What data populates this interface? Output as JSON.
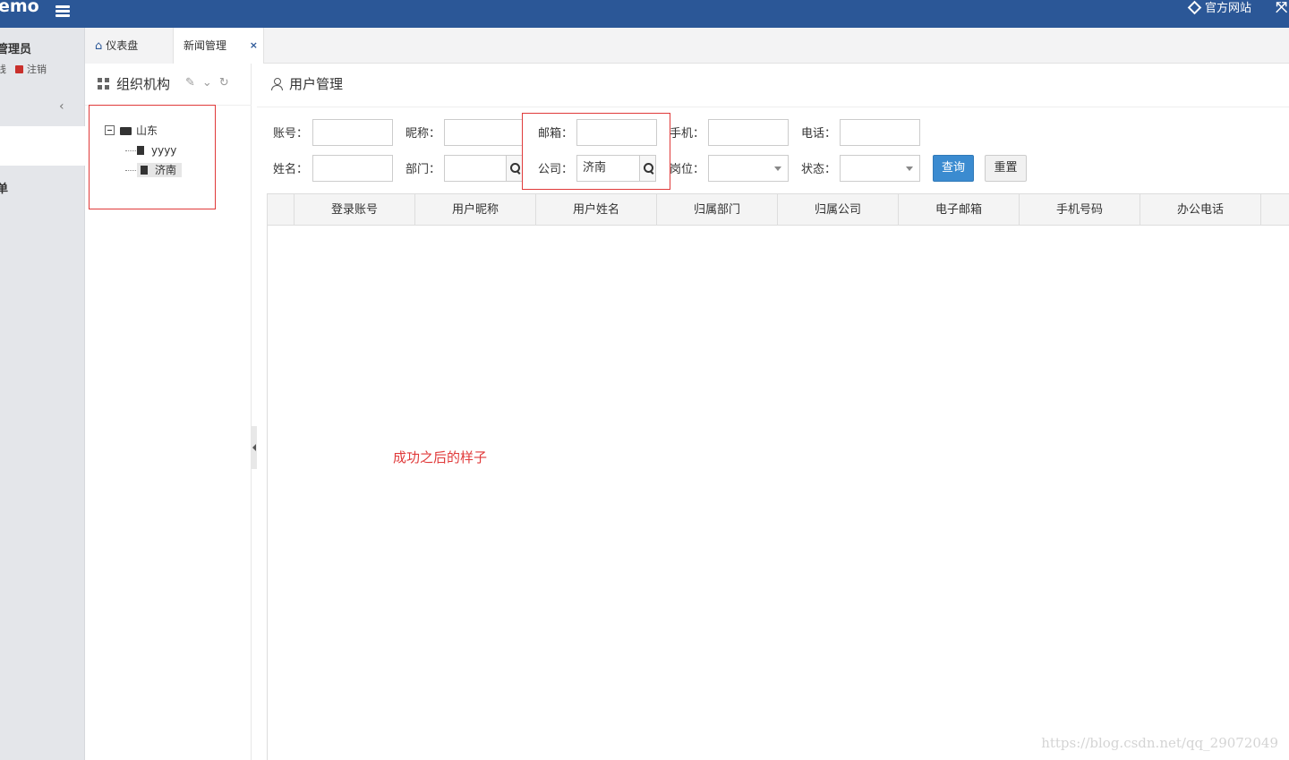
{
  "topbar": {
    "brand": "emo",
    "official_site": "官方网站"
  },
  "sidebar": {
    "role": "管理员",
    "left_link": "线",
    "logout": "注销",
    "menu_label": "单"
  },
  "tabs": [
    {
      "label": "仪表盘",
      "icon": "home-icon"
    },
    {
      "label": "新闻管理",
      "close": "×"
    }
  ],
  "org": {
    "title": "组织机构",
    "tree": {
      "root": "山东",
      "children": [
        "yyyy",
        "济南"
      ],
      "selected": "济南"
    }
  },
  "main": {
    "title": "用户管理",
    "form": {
      "account_label": "账号：",
      "nickname_label": "昵称：",
      "email_label": "邮箱：",
      "mobile_label": "手机：",
      "phone_label": "电话：",
      "name_label": "姓名：",
      "dept_label": "部门：",
      "company_label": "公司：",
      "company_value": "济南",
      "post_label": "岗位：",
      "status_label": "状态："
    },
    "buttons": {
      "query": "查询",
      "reset": "重置"
    },
    "columns": [
      "登录账号",
      "用户昵称",
      "用户姓名",
      "归属部门",
      "归属公司",
      "电子邮箱",
      "手机号码",
      "办公电话"
    ],
    "note": "成功之后的样子"
  },
  "watermark": "https://blog.csdn.net/qq_29072049",
  "colors": {
    "topbar": "#2b5797",
    "primary_button": "#3b8bd0",
    "annotation_red": "#e03a3a"
  }
}
